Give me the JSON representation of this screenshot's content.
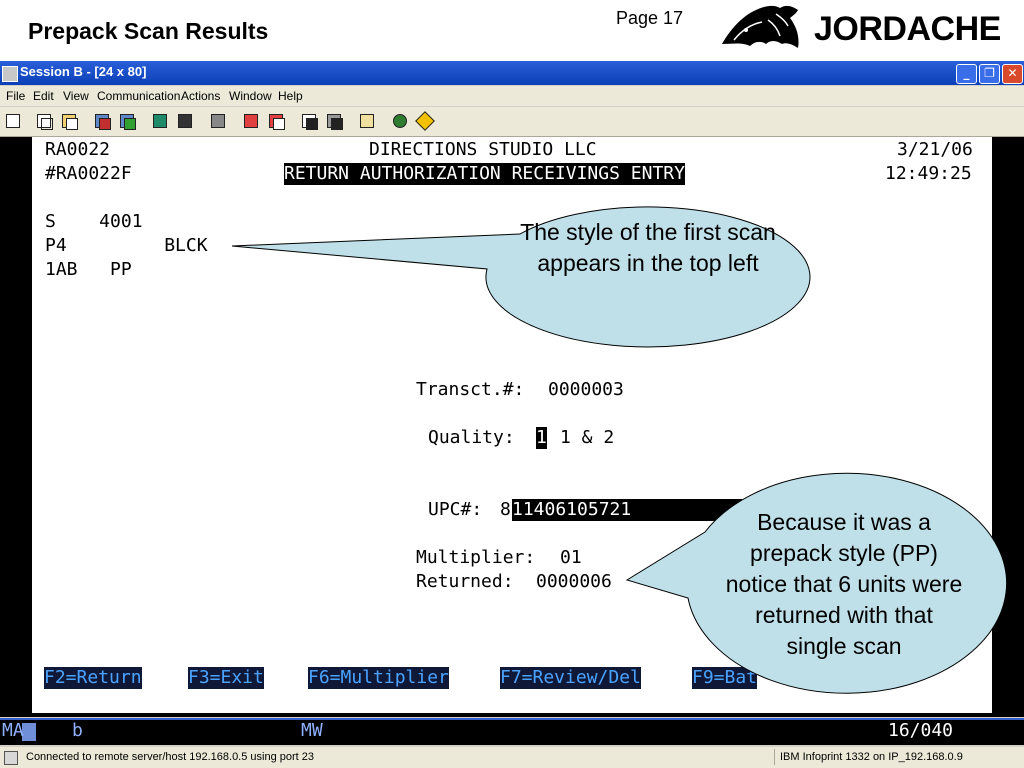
{
  "slide": {
    "title": "Prepack Scan Results",
    "page": "Page 17",
    "brand": "JORDACHE"
  },
  "window": {
    "title": "Session B - [24 x 80]",
    "buttons": [
      "_",
      "❐",
      "✕"
    ]
  },
  "menu": [
    "File",
    "Edit",
    "View",
    "Communication",
    "Actions",
    "Window",
    "Help"
  ],
  "toolbar": {
    "icons": [
      "print-screen-icon",
      "copy-icon",
      "paste-icon",
      "send-icon",
      "receive-icon",
      "display-icon",
      "keypad-icon",
      "macro-icon",
      "record-icon",
      "play-icon",
      "stop-icon",
      "settings-icon",
      "clipboard-icon",
      "globe-icon",
      "help-icon"
    ]
  },
  "terminal": {
    "program_id": "RA0022",
    "format_id": "#RA0022F",
    "company": "DIRECTIONS STUDIO LLC",
    "screen_title": "RETURN AUTHORIZATION RECEIVINGS ENTRY",
    "date": "3/21/06",
    "time": "12:49:25",
    "style_line1": "S    4001",
    "style_line2": "P4         BLCK",
    "style_line3": "1AB   PP",
    "transaction_label": "Transct.#:",
    "transaction_value": "0000003",
    "quality_label": "Quality:",
    "quality_value": "1",
    "quality_options": "1 & 2",
    "upc_label": "UPC#:",
    "upc_first_digit": "8",
    "upc_rest": "11406105721",
    "multiplier_label": "Multiplier:",
    "multiplier_value": "01",
    "returned_label": "Returned:",
    "returned_value": "0000006",
    "function_keys": [
      "F2=Return",
      "F3=Exit",
      "F6=Multiplier",
      "F7=Review/Del",
      "F9=Bat"
    ]
  },
  "status_line": {
    "mode": "MA",
    "field": "b",
    "indicator": "MW",
    "cursor_pos": "16/040"
  },
  "window_status": {
    "connection": "Connected to remote server/host 192.168.0.5 using port 23",
    "printer": "IBM Infoprint 1332 on IP_192.168.0.9"
  },
  "callouts": {
    "top": "The style of the first scan appears in the top left",
    "bottom": "Because it was a prepack style (PP) notice that 6 units were returned with that single scan"
  },
  "colors": {
    "callout_fill": "#bfe0e8",
    "function_key_text": "#4aa3ff",
    "titlebar": "#0a3fb8"
  }
}
